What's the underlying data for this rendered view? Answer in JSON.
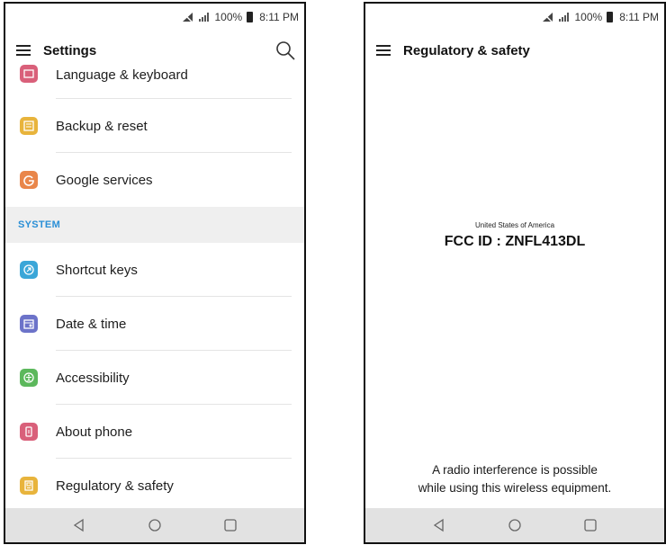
{
  "status_bar": {
    "battery": "100%",
    "time": "8:11 PM"
  },
  "settings_screen": {
    "title": "Settings",
    "items_top": [
      {
        "label": "Language & keyboard",
        "icon": "keyboard-icon",
        "color": "#d9607a"
      },
      {
        "label": "Backup & reset",
        "icon": "backup-icon",
        "color": "#e8b43c"
      },
      {
        "label": "Google services",
        "icon": "google-icon",
        "color": "#e9864a"
      }
    ],
    "section_label": "SYSTEM",
    "items_system": [
      {
        "label": "Shortcut keys",
        "icon": "shortcut-icon",
        "color": "#3aa6d8"
      },
      {
        "label": "Date & time",
        "icon": "calendar-icon",
        "color": "#6c73c9"
      },
      {
        "label": "Accessibility",
        "icon": "accessibility-icon",
        "color": "#5cb85c"
      },
      {
        "label": "About phone",
        "icon": "phone-icon",
        "color": "#d9607a"
      },
      {
        "label": "Regulatory & safety",
        "icon": "regulatory-icon",
        "color": "#e8b43c"
      }
    ]
  },
  "regulatory_screen": {
    "title": "Regulatory & safety",
    "country": "United States of America",
    "fcc_id": "FCC ID : ZNFL413DL",
    "note_line1": "A radio interference is possible",
    "note_line2": "while using this wireless equipment."
  },
  "colors": {
    "section_header_text": "#2a8fd6",
    "nav_bar": "#e2e2e2"
  }
}
